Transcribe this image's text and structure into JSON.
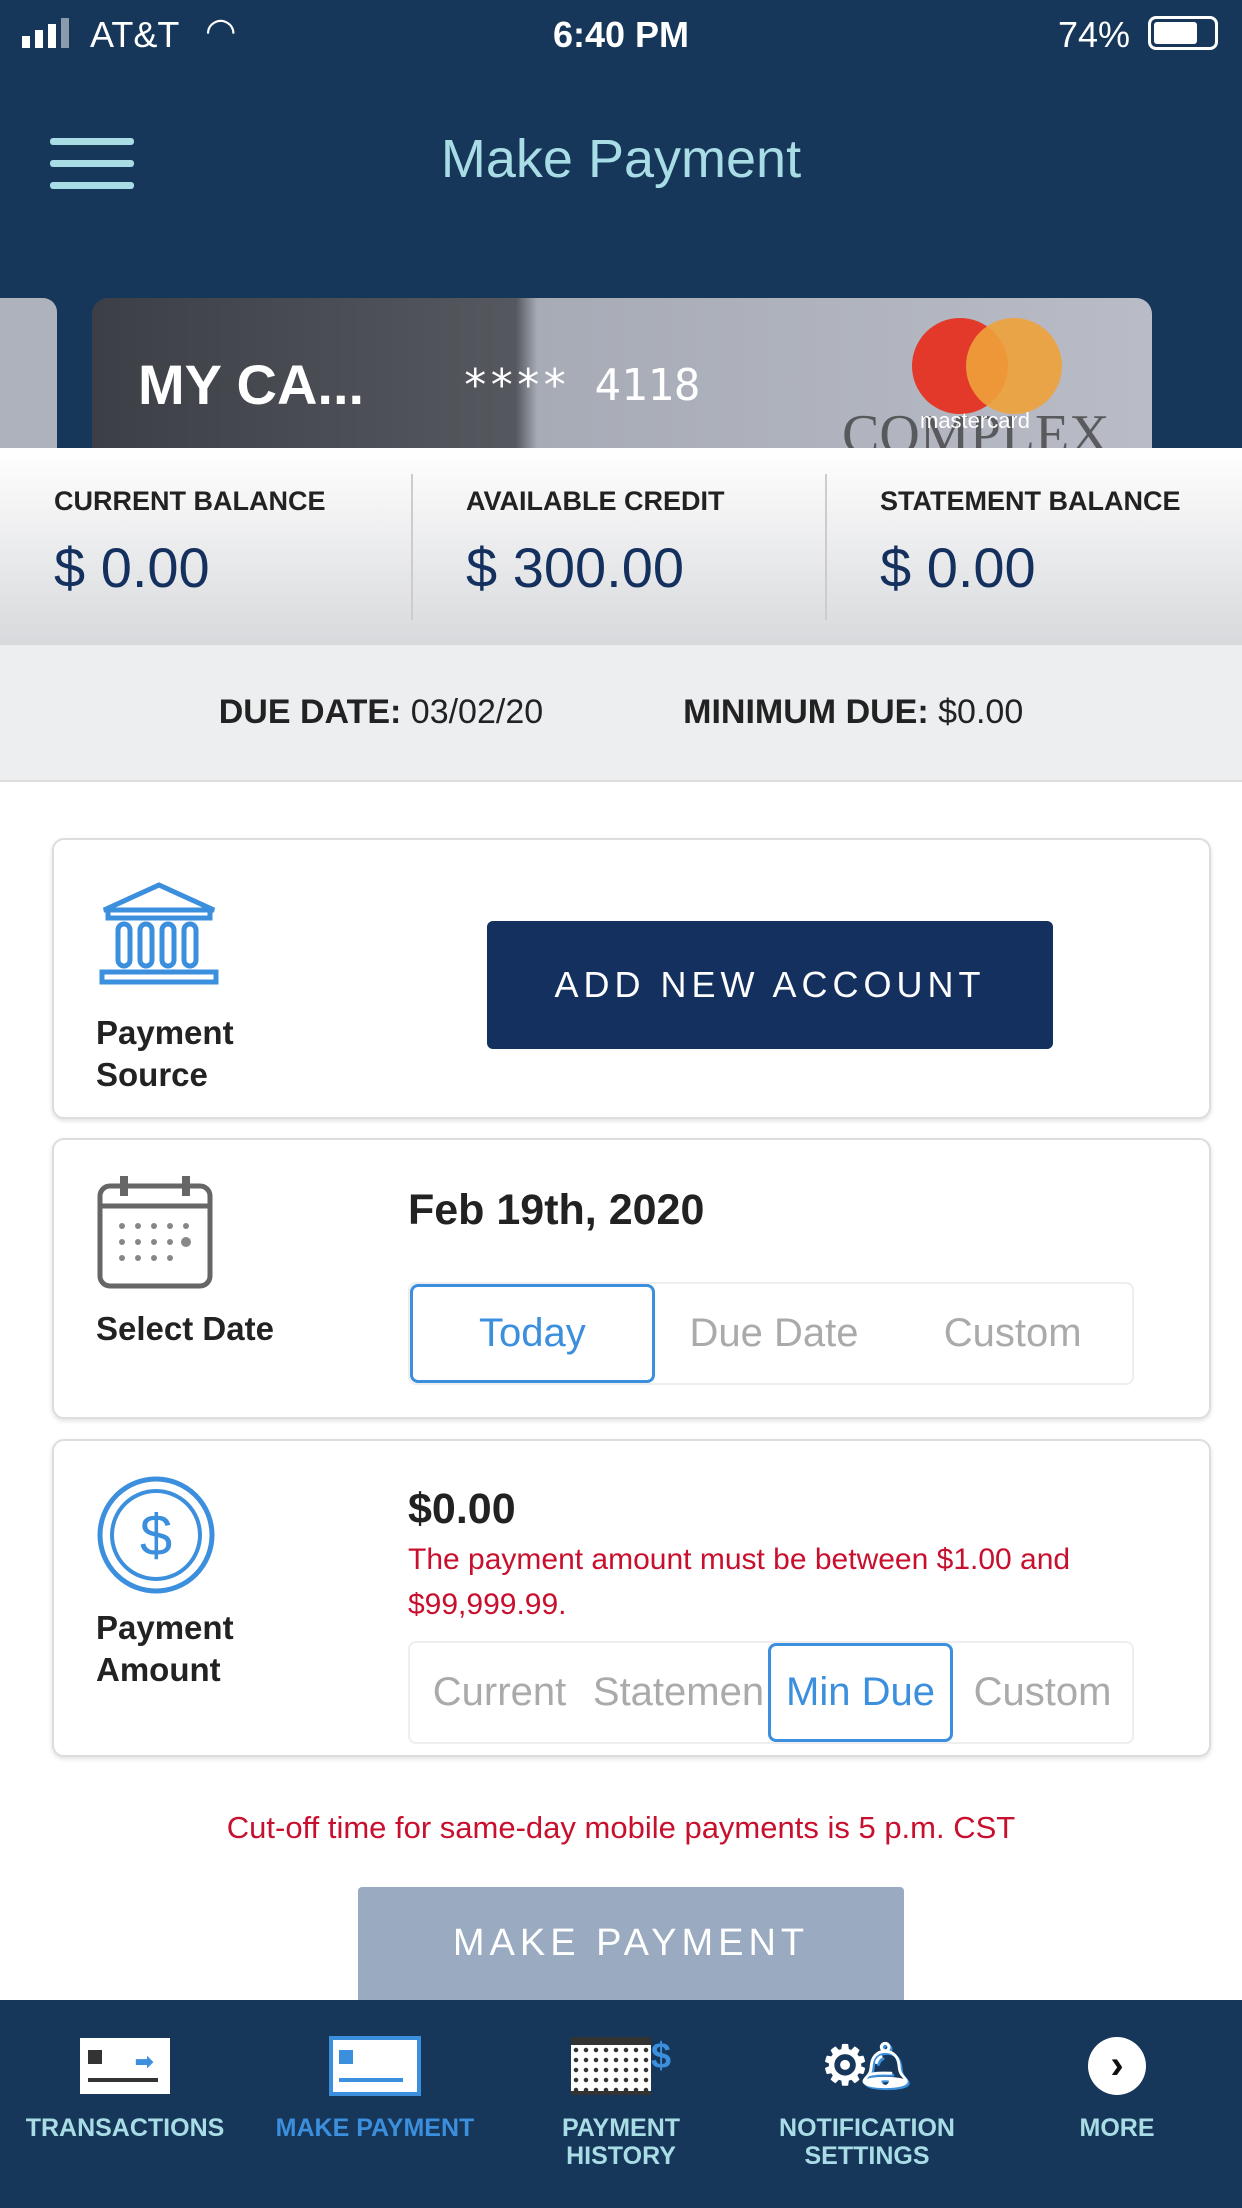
{
  "status_bar": {
    "carrier": "AT&T",
    "time": "6:40 PM",
    "battery": "74%"
  },
  "header": {
    "title": "Make Payment"
  },
  "card": {
    "name": "MY CA...",
    "number": "**** 4118",
    "brand": "mastercard",
    "background_text": "COMPLEX"
  },
  "balances": [
    {
      "label": "CURRENT BALANCE",
      "value": "$ 0.00"
    },
    {
      "label": "AVAILABLE CREDIT",
      "value": "$ 300.00"
    },
    {
      "label": "STATEMENT BALANCE",
      "value": "$ 0.00"
    }
  ],
  "due": {
    "due_date_label": "DUE DATE:",
    "due_date": "03/02/20",
    "min_due_label": "MINIMUM DUE:",
    "min_due": "$0.00"
  },
  "payment_source": {
    "label": "Payment Source",
    "button": "ADD NEW ACCOUNT"
  },
  "select_date": {
    "label": "Select Date",
    "value": "Feb 19th, 2020",
    "options": [
      "Today",
      "Due Date",
      "Custom"
    ],
    "selected": "Today"
  },
  "payment_amount": {
    "label": "Payment Amount",
    "value": "$0.00",
    "error": "The payment amount must be between $1.00 and $99,999.99.",
    "options": [
      "Current",
      "Statemen",
      "Min Due",
      "Custom"
    ],
    "selected": "Min Due"
  },
  "cutoff_notice": "Cut-off time for same-day mobile payments is 5 p.m. CST",
  "make_payment_button": "MAKE PAYMENT",
  "nav": [
    {
      "label": "TRANSACTIONS"
    },
    {
      "label": "MAKE PAYMENT",
      "active": true
    },
    {
      "label": "PAYMENT HISTORY"
    },
    {
      "label": "NOTIFICATION SETTINGS"
    },
    {
      "label": "MORE"
    }
  ],
  "colors": {
    "navy": "#16365a",
    "accent": "#3b8fdd",
    "error": "#c8102e",
    "button_dark": "#13305f",
    "button_disabled": "#9aabc1"
  }
}
